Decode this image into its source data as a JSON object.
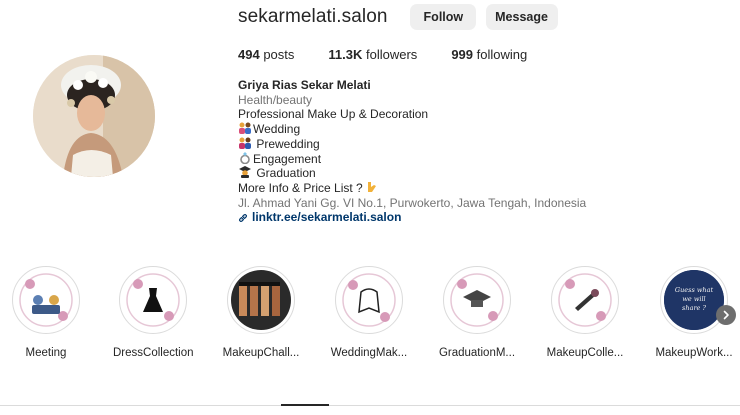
{
  "profile": {
    "username": "sekarmelati.salon",
    "follow_label": "Follow",
    "message_label": "Message"
  },
  "stats": {
    "posts_count": "494",
    "posts_label": "posts",
    "followers_count": "11.3K",
    "followers_label": "followers",
    "following_count": "999",
    "following_label": "following"
  },
  "bio": {
    "name": "Griya Rias Sekar Melati",
    "category": "Health/beauty",
    "line1": "Professional Make Up & Decoration",
    "line2": "Wedding",
    "line3": " Prewedding",
    "line4": "Engagement",
    "line5": " Graduation",
    "line6": "More Info & Price List ?",
    "address": "Jl. Ahmad Yani Gg. VI No.1, Purwokerto, Jawa Tengah, Indonesia",
    "link": "linktr.ee/sekarmelati.salon"
  },
  "highlights": [
    {
      "label": "Meeting",
      "icon": "meeting-illustration"
    },
    {
      "label": "DressCollection",
      "icon": "dress-icon"
    },
    {
      "label": "MakeupChall...",
      "icon": "foundation-bottles"
    },
    {
      "label": "WeddingMak...",
      "icon": "veil-icon"
    },
    {
      "label": "GraduationM...",
      "icon": "graduation-cap-icon"
    },
    {
      "label": "MakeupColle...",
      "icon": "makeup-brush-icon"
    },
    {
      "label": "MakeupWork...",
      "icon": "guess-what-card",
      "card_text": "Guess what we will share ?"
    }
  ],
  "colors": {
    "button_bg": "#efefef",
    "link": "#00376b",
    "muted": "#737373",
    "card_bg": "#1f3566"
  }
}
